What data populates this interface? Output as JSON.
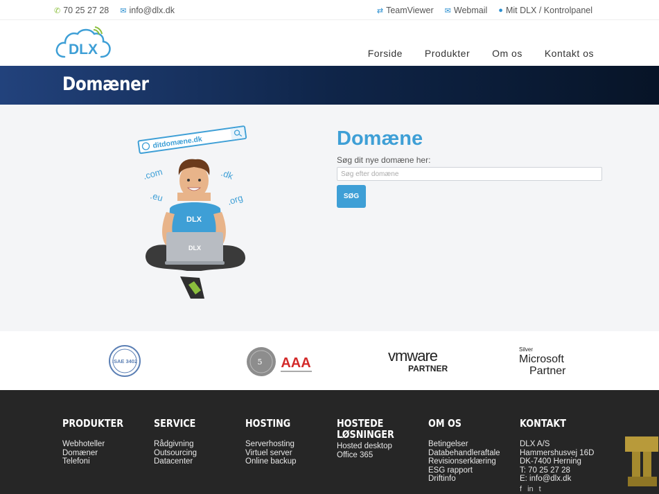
{
  "topbar": {
    "phone": "70 25 27 28",
    "email": "info@dlx.dk",
    "teamviewer": "TeamViewer",
    "webmail": "Webmail",
    "account": "Mit DLX / Kontrolpanel"
  },
  "logo": {
    "text": "DLX"
  },
  "nav": {
    "items": [
      "Forside",
      "Produkter",
      "Om os",
      "Kontakt os"
    ]
  },
  "banner": {
    "title": "Domæner"
  },
  "domain": {
    "title": "Domæne",
    "subtitle": "Søg dit nye domæne her:",
    "placeholder": "Søg efter domæne",
    "button": "SØG"
  },
  "illustration": {
    "search_text": "ditdomæne.dk",
    "tlds": [
      ".com",
      ".dk",
      ".eu",
      ".org"
    ],
    "shirt_logo": "DLX",
    "laptop_logo": "DLX"
  },
  "partners": {
    "isae": "ISAE 3402",
    "aaa": "AAA",
    "vmware": "vmware",
    "vmware_sub": "PARTNER",
    "ms_top": "Silver",
    "ms_mid": "Microsoft",
    "ms_bot": "Partner"
  },
  "footer": {
    "columns": [
      {
        "heading": "PRODUKTER",
        "links": [
          "Webhoteller",
          "Domæner",
          "Telefoni"
        ]
      },
      {
        "heading": "SERVICE",
        "links": [
          "Rådgivning",
          "Outsourcing",
          "Datacenter"
        ]
      },
      {
        "heading": "HOSTING",
        "links": [
          "Serverhosting",
          "Virtuel server",
          "Online backup"
        ]
      },
      {
        "heading": "HOSTEDE LØSNINGER",
        "links": [
          "Hosted desktop",
          "Office 365"
        ]
      },
      {
        "heading": "OM OS",
        "links": [
          "Betingelser",
          "Databehandleraftale",
          "Revisionserklæring",
          "ESG rapport",
          "Driftinfo"
        ]
      },
      {
        "heading": "KONTAKT",
        "links": [
          "DLX A/S",
          "Hammershusvej 16D",
          "DK-7400 Herning",
          "T: 70 25 27 28",
          "E: info@dlx.dk"
        ]
      }
    ],
    "social": [
      "f",
      "in",
      "t"
    ]
  },
  "colors": {
    "accent": "#3e9fd6",
    "green": "#8bbf3d",
    "banner_dark": "#071427",
    "footer_bg": "#262626"
  }
}
